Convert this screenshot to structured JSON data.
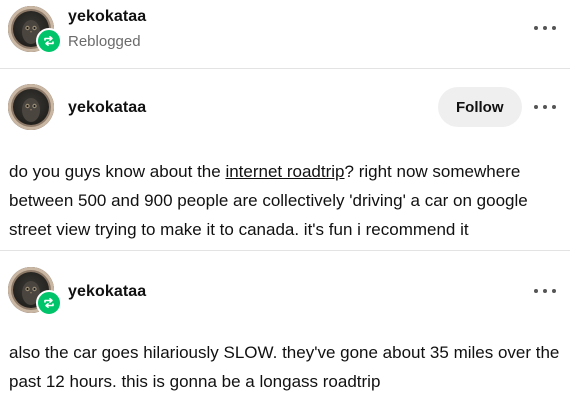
{
  "reblog_header": {
    "username": "yekokataa",
    "status": "Reblogged",
    "avatar_icon": "owl-avatar-icon",
    "badge_icon": "reblog-icon",
    "badge_color": "#00c46a"
  },
  "original_post": {
    "username": "yekokataa",
    "follow_label": "Follow",
    "text_before_link": "do you guys know about the ",
    "link_text": "internet roadtrip",
    "text_after_link": "? right now somewhere between 500 and 900 people are collectively 'driving' a car on google street view trying to make it to canada. it's fun i recommend it"
  },
  "reblog_comment": {
    "username": "yekokataa",
    "badge_icon": "reblog-icon",
    "text": "also the car goes hilariously SLOW. they've gone about 35 miles over the past 12 hours. this is gonna be a longass roadtrip"
  },
  "colors": {
    "divider": "#e3e3e3",
    "muted_text": "#6b6b6b",
    "follow_button_bg": "#efefef"
  }
}
